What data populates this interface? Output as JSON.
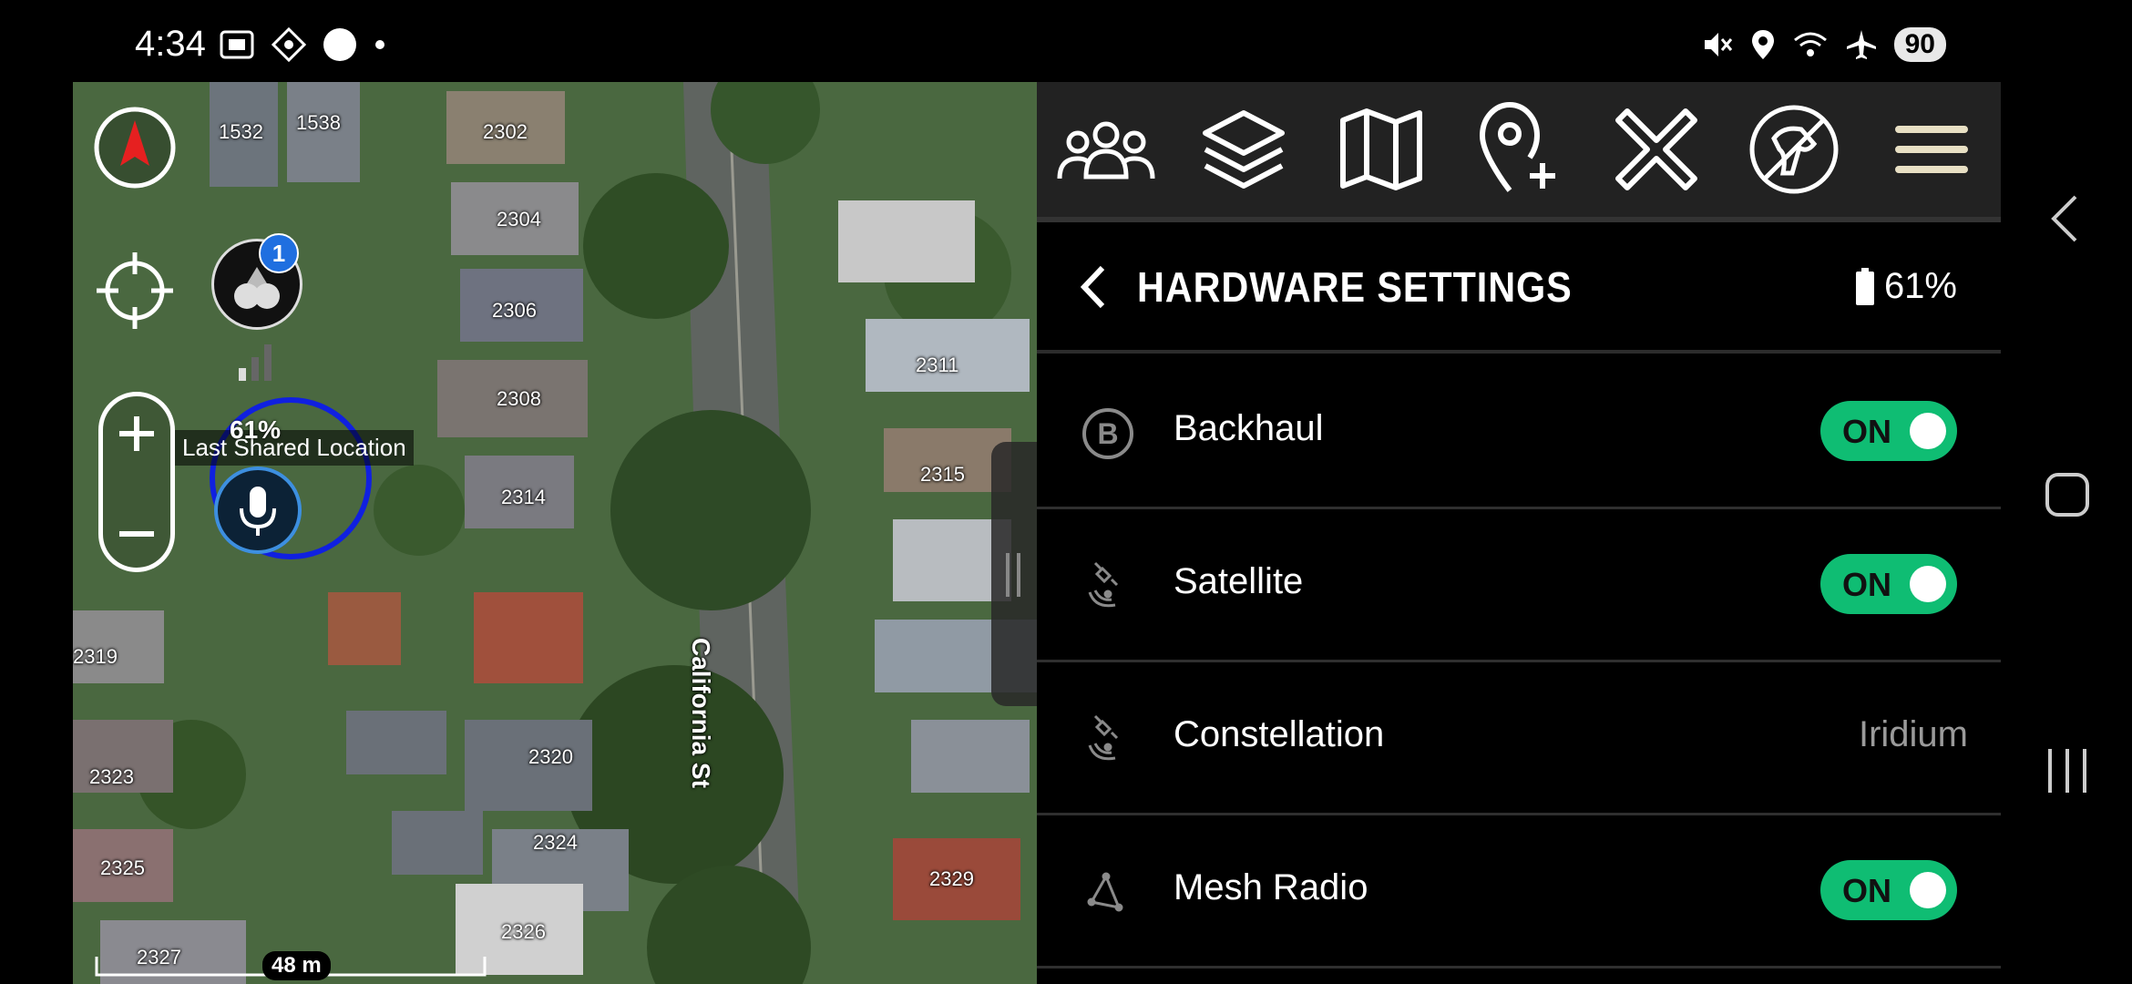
{
  "status_bar": {
    "time": "4:34",
    "left_icons": [
      "screenshot-icon",
      "gps-tool-icon",
      "circle-icon",
      "dot-icon"
    ],
    "right_icons": [
      "mute-icon",
      "location-icon",
      "wifi-icon",
      "airplane-icon"
    ],
    "battery": "90"
  },
  "map": {
    "house_numbers": [
      "1532",
      "1538",
      "2302",
      "2304",
      "2306",
      "2308",
      "2311",
      "2314",
      "2315",
      "2319",
      "2320",
      "2323",
      "2324",
      "2325",
      "2326",
      "2327",
      "2329"
    ],
    "street": "California St",
    "badge_count": "1",
    "device_battery": "61%",
    "last_shared_label": "Last Shared Location",
    "scale": "48 m"
  },
  "toolbar": {
    "items": [
      "team-icon",
      "layers-icon",
      "map-icon",
      "add-pin-icon",
      "close-icon",
      "dog-tracker-icon",
      "menu-icon"
    ]
  },
  "header": {
    "title": "HARDWARE SETTINGS",
    "battery": "61%"
  },
  "settings": [
    {
      "label": "Backhaul",
      "icon": "backhaul-icon",
      "type": "toggle",
      "value": "ON"
    },
    {
      "label": "Satellite",
      "icon": "satellite-icon",
      "type": "toggle",
      "value": "ON"
    },
    {
      "label": "Constellation",
      "icon": "satellite-icon",
      "type": "value",
      "value": "Iridium"
    },
    {
      "label": "Mesh Radio",
      "icon": "mesh-icon",
      "type": "toggle",
      "value": "ON"
    }
  ],
  "colors": {
    "toggle_on": "#0fbd73",
    "toolbar_bg": "#222222",
    "accent_blue": "#1f6fe0"
  }
}
